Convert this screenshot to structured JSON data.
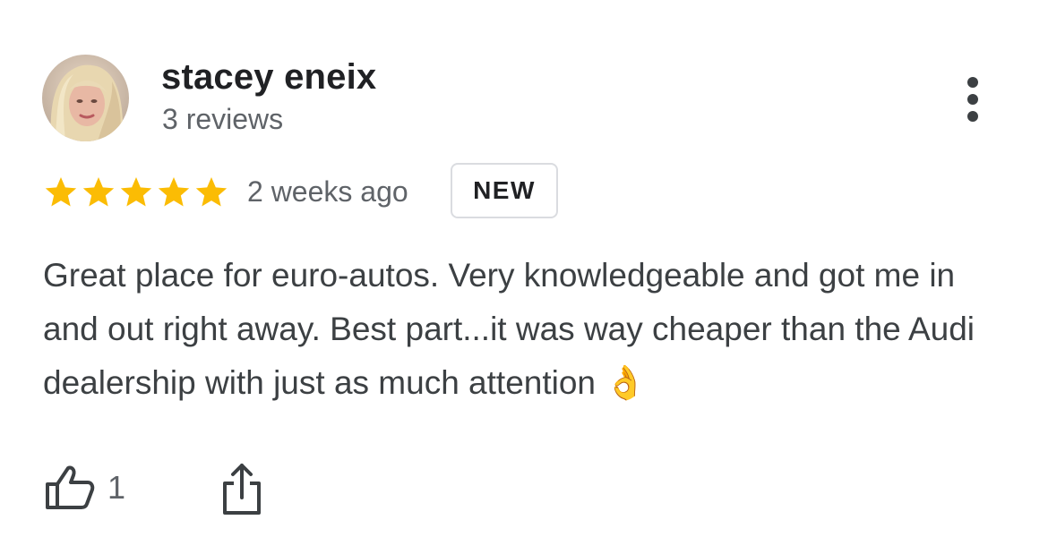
{
  "author": {
    "name": "stacey eneix",
    "reviews": "3 reviews"
  },
  "rating": {
    "stars": 5,
    "max": 5,
    "color": "#fbbc04"
  },
  "time_ago": "2 weeks ago",
  "badge": "NEW",
  "review_text": "Great place for euro-autos. Very knowledgeable and got me in and out right away. Best part...it was way cheaper than the Audi dealership with just as much attention 👌",
  "actions": {
    "like_count": "1"
  },
  "icons": {
    "more": "more-vert-icon",
    "like": "thumb-up-icon",
    "share": "share-icon"
  }
}
